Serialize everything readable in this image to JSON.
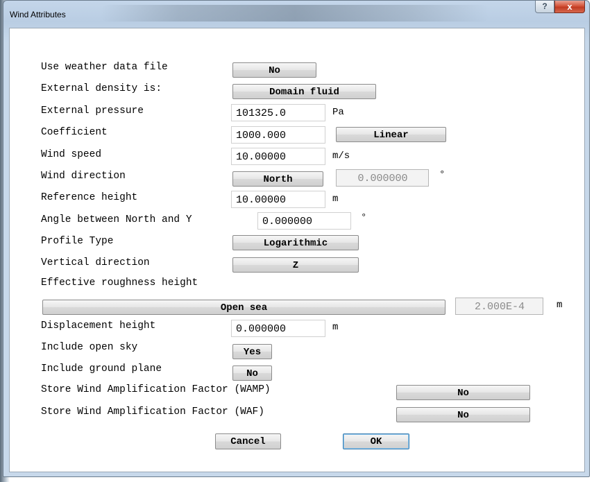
{
  "window": {
    "title": "Wind Attributes",
    "help_label": "?",
    "close_label": "x"
  },
  "form": {
    "use_weather": {
      "label": "Use weather data file",
      "button": "No"
    },
    "external_density": {
      "label": "External density is:",
      "button": "Domain fluid"
    },
    "external_pressure": {
      "label": "External pressure",
      "value": "101325.0",
      "unit": "Pa"
    },
    "coefficient": {
      "label": "Coefficient",
      "value": "1000.000",
      "button": "Linear"
    },
    "wind_speed": {
      "label": "Wind speed",
      "value": "10.00000",
      "unit": "m/s"
    },
    "wind_direction": {
      "label": "Wind direction",
      "button": "North",
      "value": "0.000000",
      "unit": "°"
    },
    "reference_height": {
      "label": "Reference height",
      "value": "10.00000",
      "unit": "m"
    },
    "angle_north_y": {
      "label": "Angle between North and Y",
      "value": "0.000000",
      "unit": "°"
    },
    "profile_type": {
      "label": "Profile Type",
      "button": "Logarithmic"
    },
    "vertical_direction": {
      "label": "Vertical direction",
      "button": "Z"
    },
    "roughness": {
      "label": "Effective roughness height",
      "button": "Open sea",
      "value": "2.000E-4",
      "unit": "m"
    },
    "displacement_height": {
      "label": "Displacement height",
      "value": "0.000000",
      "unit": "m"
    },
    "open_sky": {
      "label": "Include open sky",
      "button": "Yes"
    },
    "ground_plane": {
      "label": "Include ground plane",
      "button": "No"
    },
    "wamp": {
      "label": "Store Wind Amplification Factor (WAMP)",
      "button": "No"
    },
    "waf": {
      "label": "Store Wind Amplification Factor (WAF)",
      "button": "No"
    }
  },
  "actions": {
    "cancel": "Cancel",
    "ok": "OK"
  },
  "colors": {
    "ok_border": "#3c7fb1",
    "close_button": "#c13b22",
    "disabled_text": "#8a8a8a"
  }
}
